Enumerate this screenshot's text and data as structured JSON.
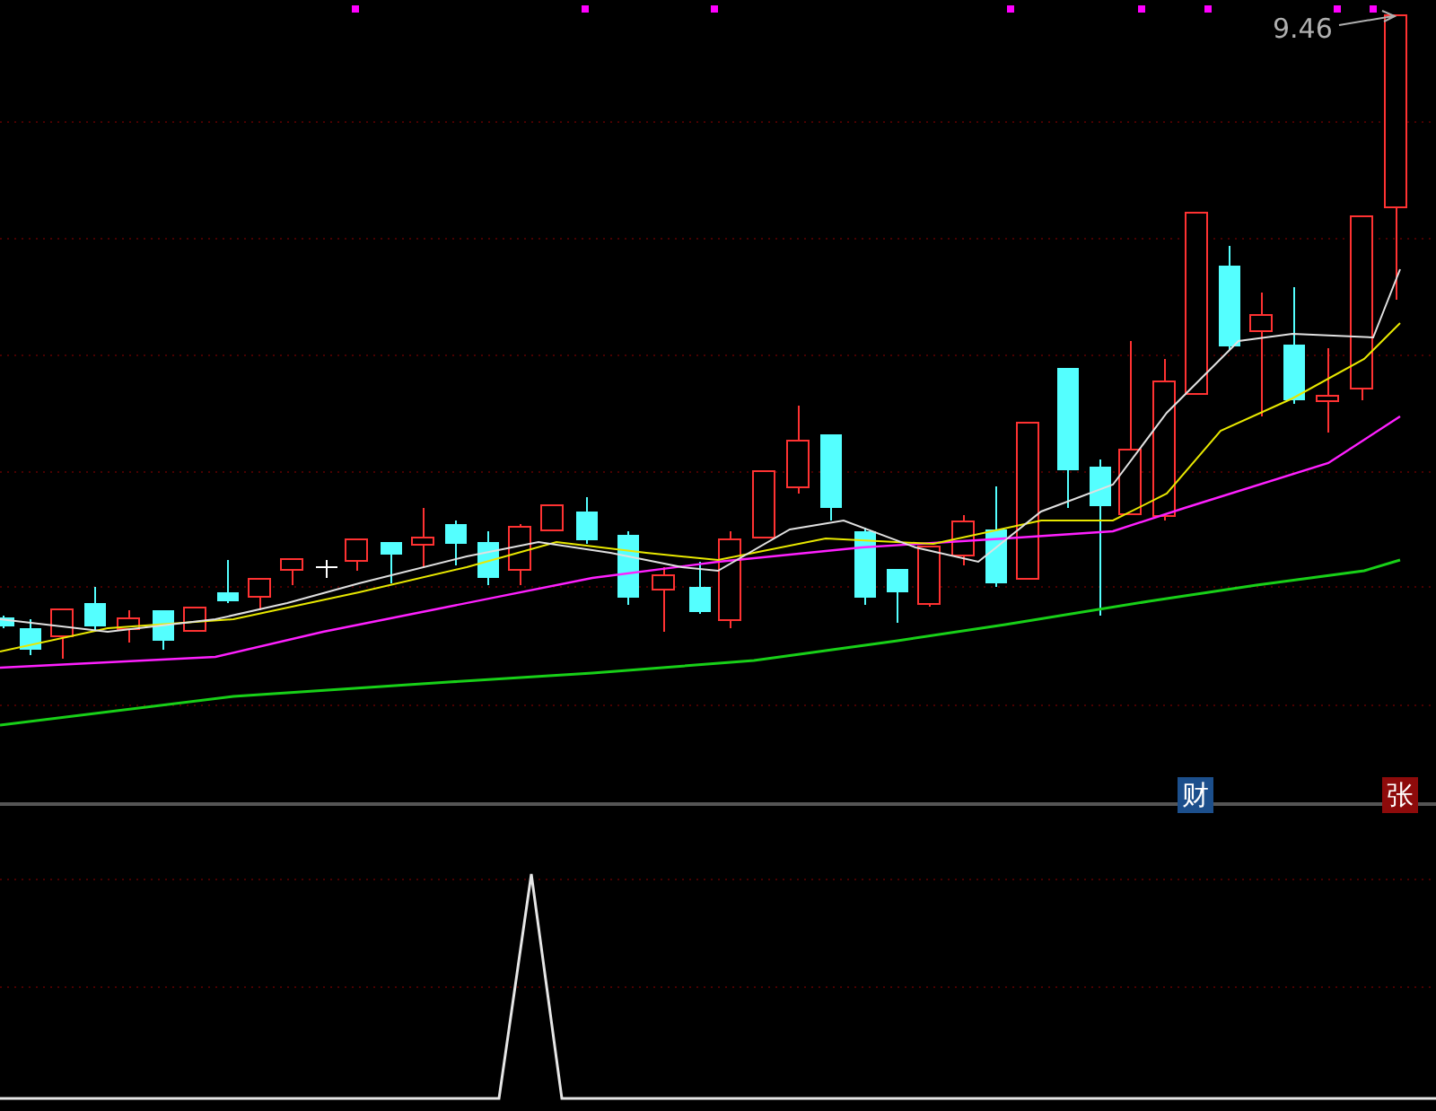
{
  "main_chart": {
    "price_label": "9.46"
  },
  "badges": [
    {
      "text": "财",
      "color": "#1c4f8c"
    },
    {
      "text": "张",
      "color": "#8e0b0b"
    }
  ]
}
